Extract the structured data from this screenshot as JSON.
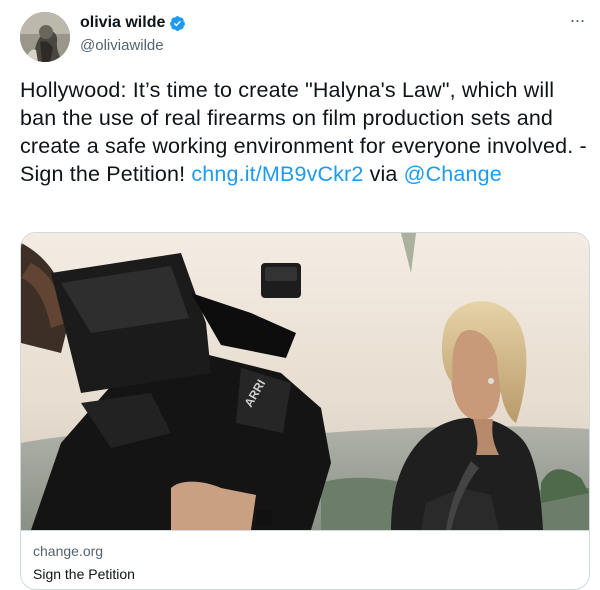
{
  "author": {
    "display_name": "olivia wilde",
    "handle": "@oliviawilde",
    "verified": true,
    "verified_color": "#1d9bf0"
  },
  "tweet": {
    "text_before": "Hollywood: It’s time to create \"Halyna's Law\", which will ban the use of real firearms on film production sets and create a safe working environment for everyone involved. - Sign the Petition! ",
    "link_text": "chng.it/MB9vCkr2",
    "text_middle": " via ",
    "mention": "@Change",
    "link_color": "#1d9bf0"
  },
  "card": {
    "domain": "change.org",
    "title": "Sign the Petition"
  },
  "icons": {
    "more": "more-options-icon",
    "verified": "verified-badge-icon"
  },
  "more_glyph": "···"
}
